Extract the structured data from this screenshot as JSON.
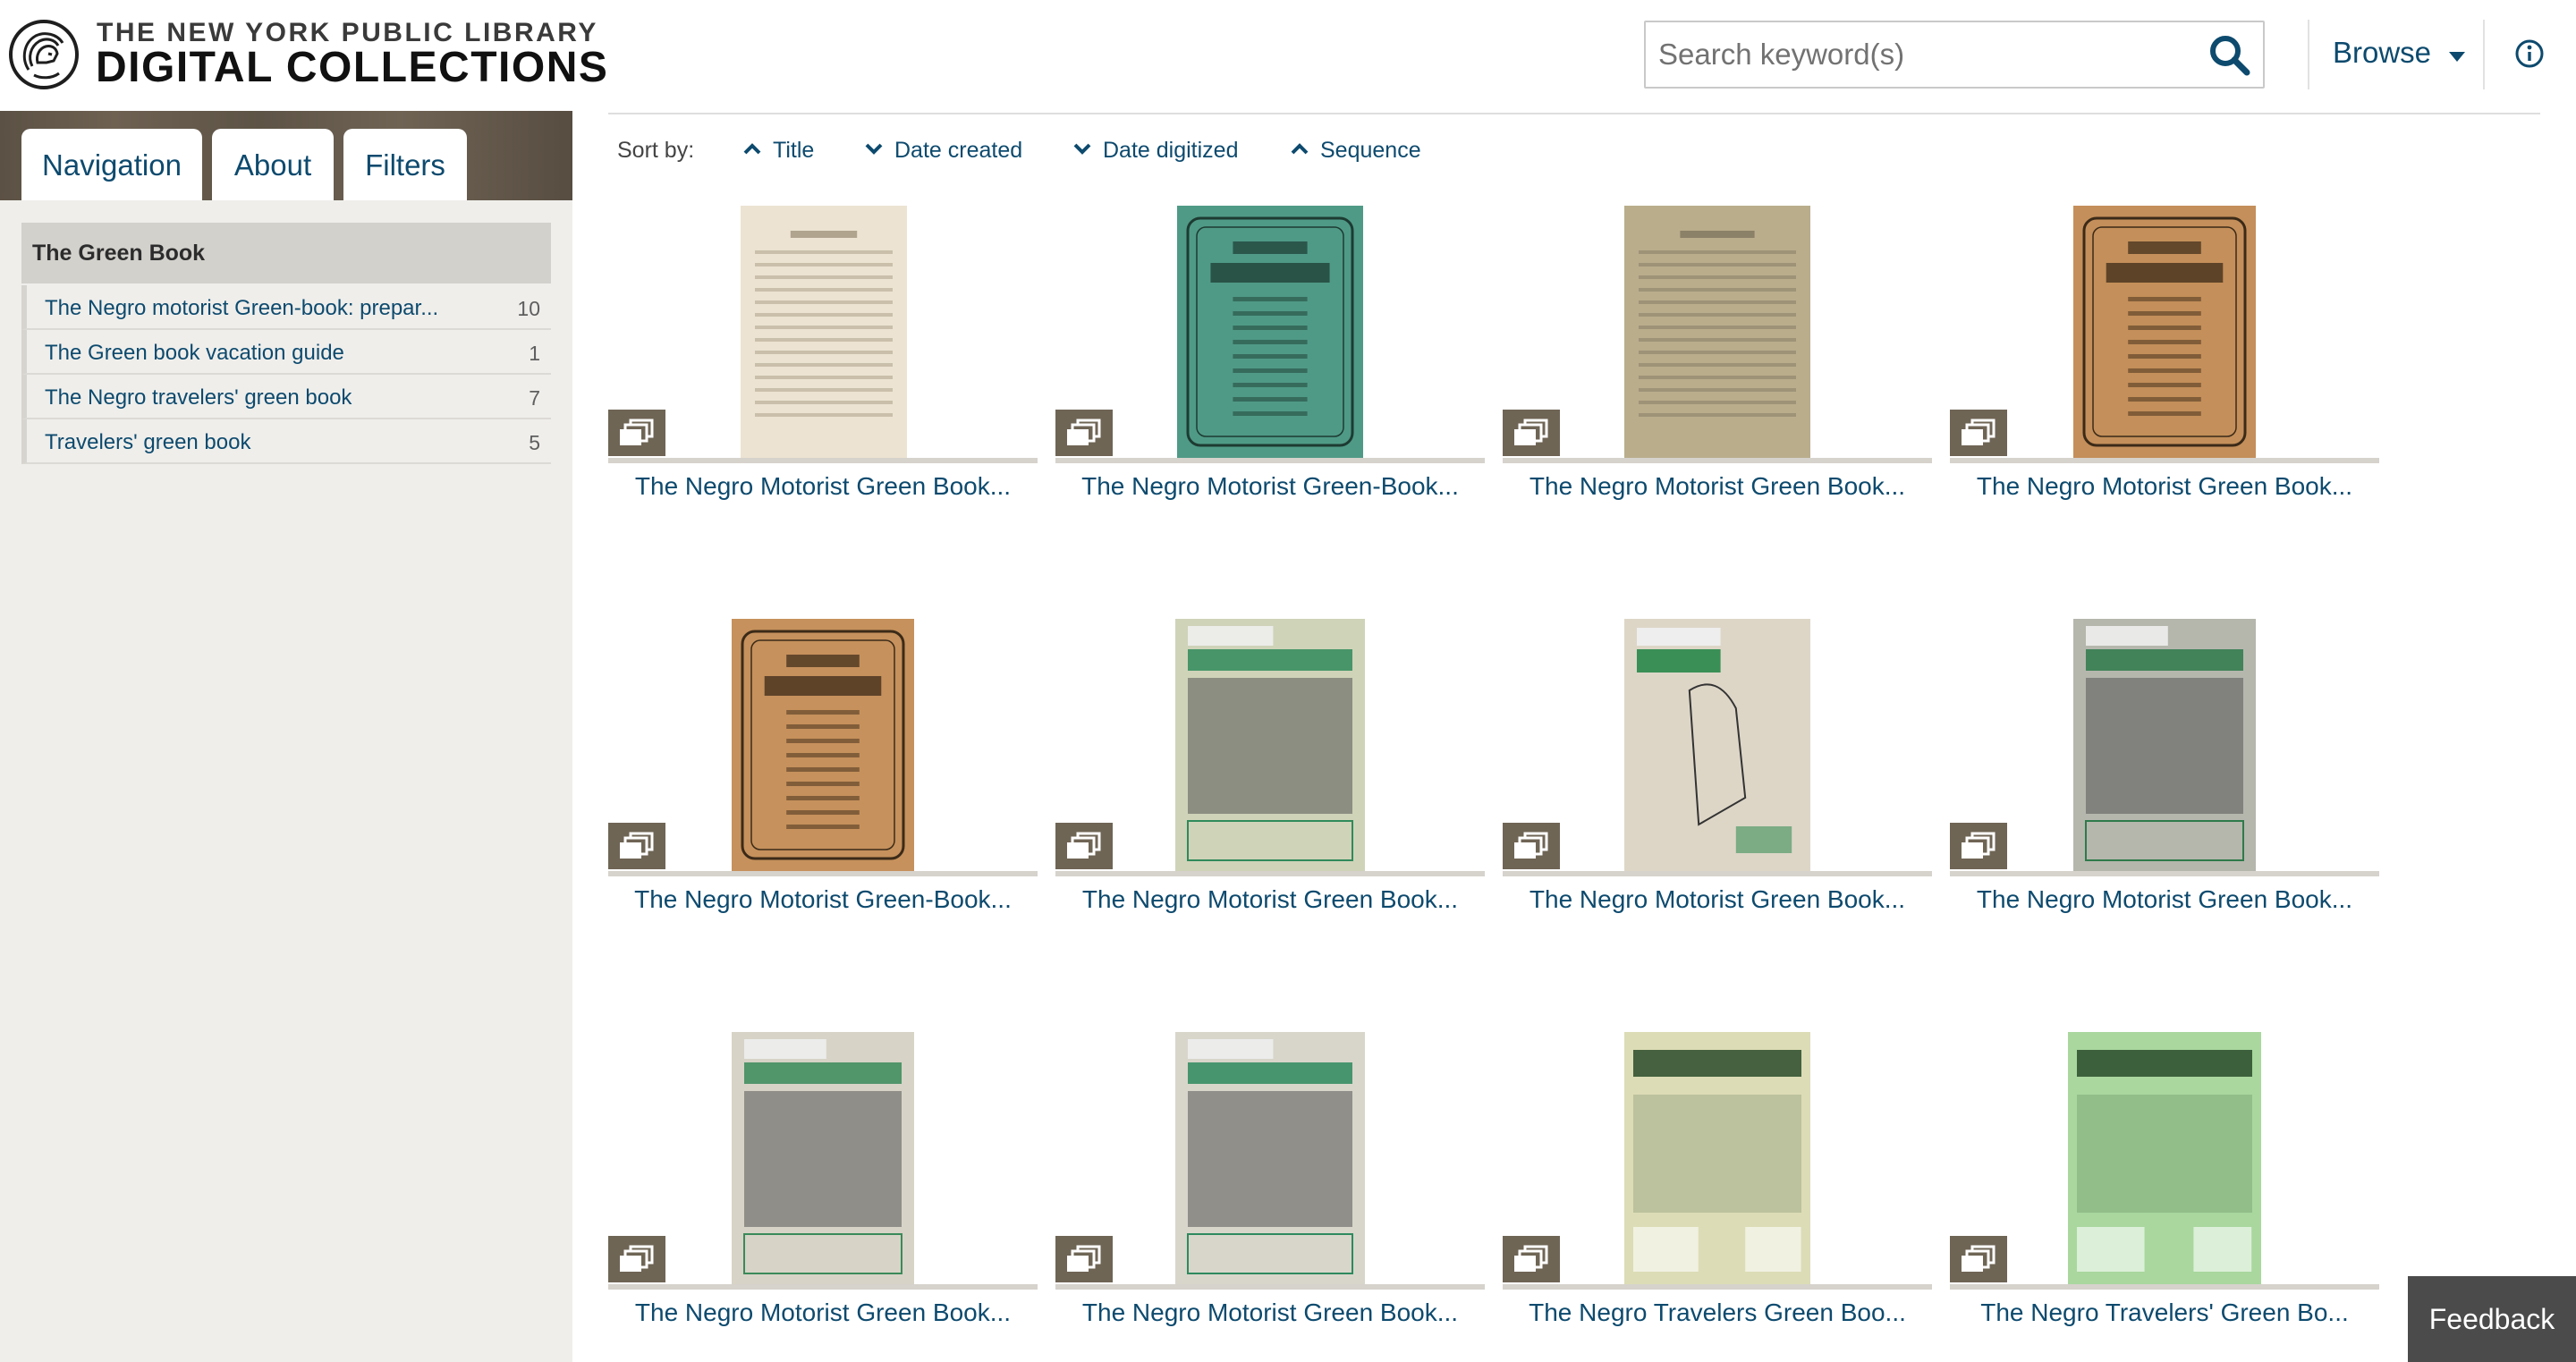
{
  "header": {
    "brand_top": "THE NEW YORK PUBLIC LIBRARY",
    "brand_bottom": "DIGITAL COLLECTIONS",
    "logo_icon": "nypl-lion-icon",
    "search_placeholder": "Search keyword(s)",
    "search_icon": "search-icon",
    "browse_label": "Browse",
    "info_icon": "info-icon"
  },
  "sidebar": {
    "tabs": [
      {
        "label": "Navigation"
      },
      {
        "label": "About"
      },
      {
        "label": "Filters"
      }
    ],
    "collection_title": "The Green Book",
    "items": [
      {
        "label": "The Negro motorist Green-book: prepar...",
        "count": "10"
      },
      {
        "label": "The Green book vacation guide",
        "count": "1"
      },
      {
        "label": "The Negro travelers' green book",
        "count": "7"
      },
      {
        "label": "Travelers' green book",
        "count": "5"
      }
    ]
  },
  "sort": {
    "label": "Sort by:",
    "options": [
      {
        "label": "Title",
        "direction": "up"
      },
      {
        "label": "Date created",
        "direction": "down"
      },
      {
        "label": "Date digitized",
        "direction": "down"
      },
      {
        "label": "Sequence",
        "direction": "up"
      }
    ]
  },
  "items": [
    {
      "title": "The Negro Motorist Green Book...",
      "cover": {
        "bg": "#ece3d2",
        "ink": "#8a7a62",
        "style": "text"
      }
    },
    {
      "title": "The Negro Motorist Green-Book...",
      "cover": {
        "bg": "#4f9a86",
        "ink": "#1d3b32",
        "style": "frame"
      }
    },
    {
      "title": "The Negro Motorist Green Book...",
      "cover": {
        "bg": "#b9ad8c",
        "ink": "#6d6450",
        "style": "text"
      }
    },
    {
      "title": "The Negro Motorist Green Book...",
      "cover": {
        "bg": "#c48f5a",
        "ink": "#3b2a18",
        "style": "frame"
      }
    },
    {
      "title": "The Negro Motorist Green-Book...",
      "cover": {
        "bg": "#c6915c",
        "ink": "#3b2a18",
        "style": "frame"
      }
    },
    {
      "title": "The Negro Motorist Green Book...",
      "cover": {
        "bg": "#cfd3b8",
        "ink": "#2f8a5a",
        "style": "photo"
      }
    },
    {
      "title": "The Negro Motorist Green Book...",
      "cover": {
        "bg": "#ddd6c7",
        "ink": "#3a8f56",
        "style": "sketch"
      }
    },
    {
      "title": "The Negro Motorist Green Book...",
      "cover": {
        "bg": "#b5b7ad",
        "ink": "#2e7a4a",
        "style": "photo"
      }
    },
    {
      "title": "The Negro Motorist Green Book...",
      "cover": {
        "bg": "#d7d3c6",
        "ink": "#3a8a5a",
        "style": "photo"
      }
    },
    {
      "title": "The Negro Motorist Green Book...",
      "cover": {
        "bg": "#d8d6cb",
        "ink": "#2e8a5e",
        "style": "photo"
      }
    },
    {
      "title": "The Negro Travelers Green Boo...",
      "cover": {
        "bg": "#dcdcb6",
        "ink": "#2a4b2a",
        "style": "light"
      }
    },
    {
      "title": "The Negro Travelers' Green Bo...",
      "cover": {
        "bg": "#a9d79e",
        "ink": "#2a4b2a",
        "style": "light"
      }
    }
  ],
  "feedback_label": "Feedback",
  "colors": {
    "link": "#0d4a6e",
    "sidebar_bg": "#efeeeb",
    "stack_button": "#6f6555",
    "feedback_bg": "#4b4b4b"
  }
}
